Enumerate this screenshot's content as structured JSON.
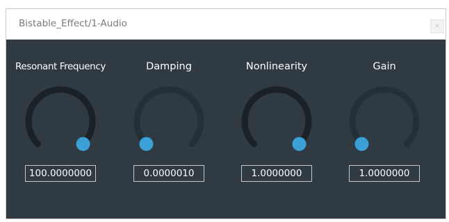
{
  "window": {
    "title": "Bistable_Effect/1-Audio",
    "close_glyph": "×"
  },
  "colors": {
    "panel_background": "#2f3a42",
    "knob_track": "#243037",
    "knob_fill": "#1a2227",
    "knob_handle": "#3aa0d5",
    "label_text": "#ffffff",
    "value_border": "#c8c8c8"
  },
  "knobs": [
    {
      "label": "Resonant Frequency",
      "value": "100.0000000",
      "position": 1.0
    },
    {
      "label": "Damping",
      "value": "0.0000010",
      "position": 0.0
    },
    {
      "label": "Nonlinearity",
      "value": "1.0000000",
      "position": 1.0
    },
    {
      "label": "Gain",
      "value": "1.0000000",
      "position": 0.0
    }
  ]
}
